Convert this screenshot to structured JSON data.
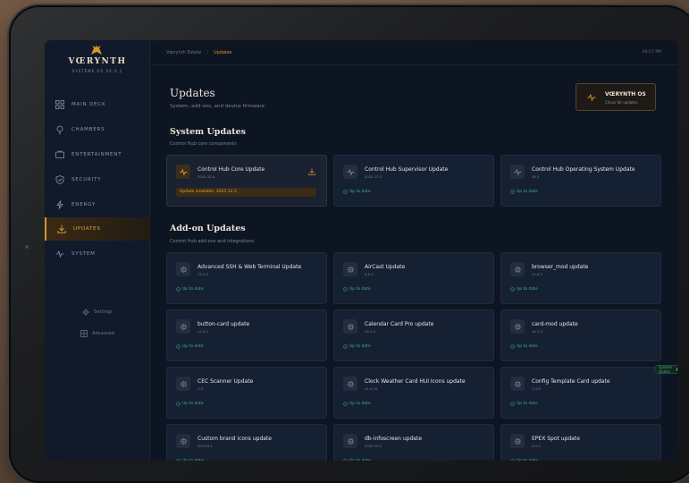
{
  "brand": {
    "name": "VŒRYNTH",
    "subtitle": "SYSTÈME OS V4.0.1"
  },
  "nav": [
    {
      "label": "MAIN DECK",
      "icon": "grid-icon"
    },
    {
      "label": "CHAMBERS",
      "icon": "lightbulb-icon"
    },
    {
      "label": "ENTERTAINMENT",
      "icon": "tv-icon"
    },
    {
      "label": "SECURITY",
      "icon": "shield-icon"
    },
    {
      "label": "ENERGY",
      "icon": "bolt-icon"
    },
    {
      "label": "UPDATES",
      "icon": "download-icon",
      "active": true
    },
    {
      "label": "SYSTEM",
      "icon": "pulse-icon"
    }
  ],
  "side_links": {
    "settings": "Settings",
    "advanced": "Advanced"
  },
  "breadcrumb": {
    "home": "Vœrynth Estate",
    "sep": "/",
    "current": "Updates"
  },
  "clock": "04:17 PM",
  "page": {
    "title": "Updates",
    "subtitle": "System, add-ons, and device firmware"
  },
  "os_button": {
    "title": "VŒRYNTH OS",
    "subtitle": "Check for updates"
  },
  "system_section": {
    "title": "System Updates",
    "subtitle": "Control Hub core components"
  },
  "system_cards": [
    {
      "title": "Control Hub Core Update",
      "version": "2025.12.4",
      "available": "Update available: 2025.12.5"
    },
    {
      "title": "Control Hub Supervisor Update",
      "version": "2025.12.3",
      "status": "Up to date"
    },
    {
      "title": "Control Hub Operating System Update",
      "version": "16.3",
      "status": "Up to date"
    }
  ],
  "addon_section": {
    "title": "Add-on Updates",
    "subtitle": "Control Hub add-ons and integrations"
  },
  "addon_cards": [
    {
      "title": "Advanced SSH & Web Terminal Update",
      "version": "22.0.3",
      "status": "Up to date"
    },
    {
      "title": "AirCast Update",
      "version": "5.0.2",
      "status": "Up to date"
    },
    {
      "title": "browser_mod update",
      "version": "v2.6.4",
      "status": "Up to date"
    },
    {
      "title": "button-card update",
      "version": "v7.0.1",
      "status": "Up to date"
    },
    {
      "title": "Calendar Card Pro update",
      "version": "v3.1.0",
      "status": "Up to date"
    },
    {
      "title": "card-mod update",
      "version": "v4.1.0",
      "status": "Up to date"
    },
    {
      "title": "CEC Scanner Update",
      "version": "3.0",
      "status": "Up to date"
    },
    {
      "title": "Clock Weather Card HUI Icons update",
      "version": "v1.0.10",
      "status": "Up to date"
    },
    {
      "title": "Config Template Card update",
      "version": "1.3.6",
      "status": "Up to date"
    },
    {
      "title": "Custom brand icons update",
      "version": "2025.8.1",
      "status": "Up to date"
    },
    {
      "title": "db-infoscreen update",
      "version": "2025.10.2",
      "status": "Up to date"
    },
    {
      "title": "EPEX Spot update",
      "version": "4.0.0",
      "status": "Up to date"
    }
  ],
  "status_badge": "System Online",
  "colors": {
    "accent": "#d8952c",
    "ok": "#3fb27f",
    "bg": "#0d1422"
  }
}
